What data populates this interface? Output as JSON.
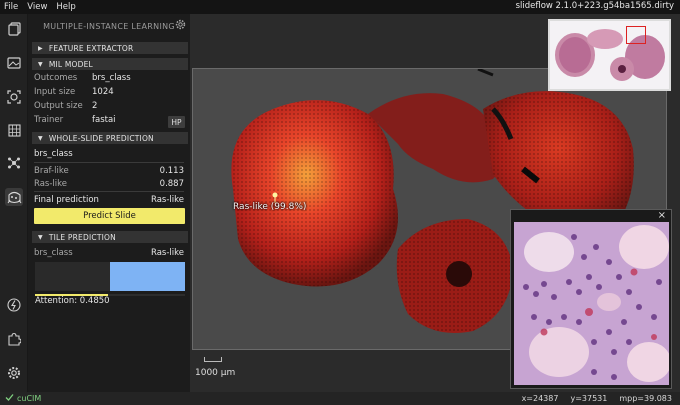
{
  "menu": {
    "items": [
      "File",
      "View",
      "Help"
    ],
    "version": "slideflow 2.1.0+223.g54ba1565.dirty"
  },
  "rail": {
    "icons": [
      "copy-icon",
      "slide-icon",
      "focus-icon",
      "grid-icon",
      "molecule-icon",
      "mil-icon",
      "extension-icon",
      "puzzle-icon",
      "settings-icon"
    ]
  },
  "panel": {
    "title": "MULTIPLE-INSTANCE LEARNING",
    "feature_extractor": {
      "label": "FEATURE EXTRACTOR"
    },
    "mil_model": {
      "label": "MIL MODEL",
      "rows": [
        {
          "key": "Outcomes",
          "value": "brs_class"
        },
        {
          "key": "Input size",
          "value": "1024"
        },
        {
          "key": "Output size",
          "value": "2"
        },
        {
          "key": "Trainer",
          "value": "fastai"
        }
      ],
      "hp_button": "HP"
    },
    "wsp": {
      "label": "WHOLE-SLIDE PREDICTION",
      "outcome": "brs_class",
      "predictions": [
        {
          "label": "Braf-like",
          "value": "0.113"
        },
        {
          "label": "Ras-like",
          "value": "0.887"
        }
      ],
      "final_label": "Final prediction",
      "final_value": "Ras-like",
      "predict_button": "Predict Slide"
    },
    "tile": {
      "label": "TILE PREDICTION",
      "outcome": "brs_class",
      "prediction": "Ras-like",
      "attention_label": "Attention: 0.4850",
      "attention": 0.485,
      "bar_fraction": 0.5
    }
  },
  "viewer": {
    "annotation": "Ras-like (99.8%)",
    "scale": "1000 μm",
    "close": "×"
  },
  "status": {
    "backend": "cuCIM",
    "x": "x=24387",
    "y": "y=37531",
    "mpp": "mpp=39.083"
  },
  "colors": {
    "accent_yellow": "#f2ea6b",
    "tile_bar_blue": "#7eb3f4",
    "heat_red": "#c8281c",
    "backend_green": "#80d080"
  }
}
